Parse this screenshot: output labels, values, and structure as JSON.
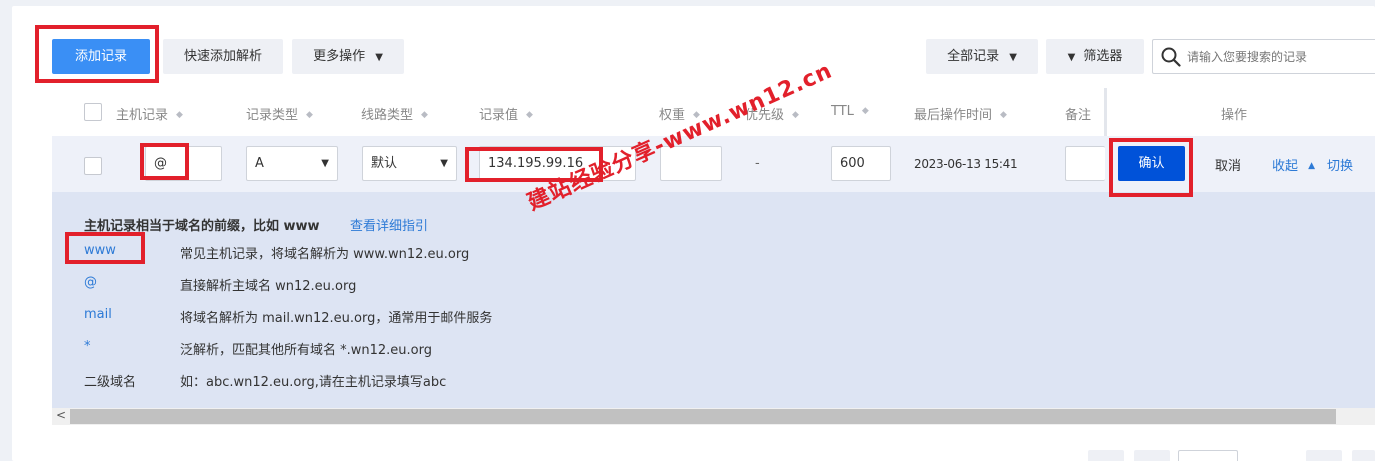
{
  "toolbar": {
    "add_record": "添加记录",
    "quick_add": "快速添加解析",
    "more_ops": "更多操作",
    "all_records": "全部记录",
    "filter": "筛选器",
    "search_placeholder": "请输入您要搜索的记录"
  },
  "table": {
    "headers": {
      "host": "主机记录",
      "type": "记录类型",
      "line": "线路类型",
      "value": "记录值",
      "weight": "权重",
      "priority": "优先级",
      "ttl": "TTL",
      "last_op": "最后操作时间",
      "note": "备注",
      "actions": "操作"
    }
  },
  "edit_row": {
    "host": "@",
    "type": "A",
    "line": "默认",
    "value": "134.195.99.16",
    "weight": "",
    "priority": "-",
    "ttl": "600",
    "last_op": "2023-06-13 15:41",
    "note": "",
    "confirm": "确认",
    "cancel": "取消",
    "collapse": "收起",
    "switch": "切换"
  },
  "help": {
    "title": "主机记录相当于域名的前缀，比如 www",
    "guide_link": "查看详细指引",
    "items": [
      {
        "key": "www",
        "desc": "常见主机记录，将域名解析为 www.wn12.eu.org"
      },
      {
        "key": "@",
        "desc": "直接解析主域名 wn12.eu.org"
      },
      {
        "key": "mail",
        "desc": "将域名解析为 mail.wn12.eu.org，通常用于邮件服务"
      },
      {
        "key": "*",
        "desc": "泛解析，匹配其他所有域名 *.wn12.eu.org"
      },
      {
        "key": "二级域名",
        "desc": "如：abc.wn12.eu.org,请在主机记录填写abc"
      }
    ]
  },
  "watermark": "建站经验分享-www.wn12.cn",
  "colors": {
    "primary": "#3a8ff5",
    "confirm": "#0052d9",
    "highlight_box": "#e2202b",
    "link": "#2d7ad6"
  }
}
